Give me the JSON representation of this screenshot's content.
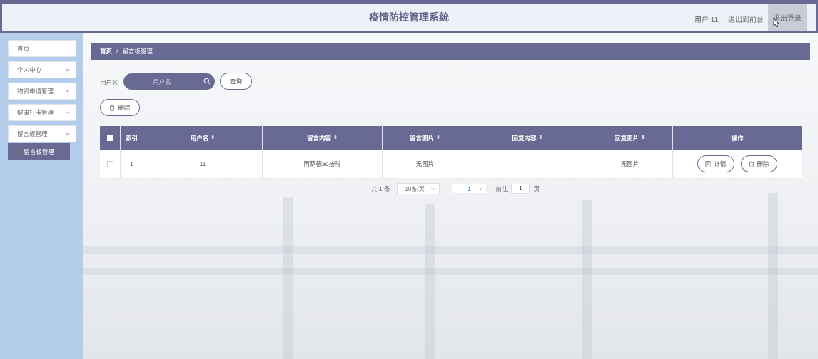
{
  "header": {
    "title": "疫情防控管理系统",
    "user": "用户 11",
    "to_front": "退出到前台",
    "logout": "退出登录"
  },
  "sidebar": {
    "items": [
      {
        "label": "首页",
        "expandable": false
      },
      {
        "label": "个人中心",
        "expandable": true
      },
      {
        "label": "物资申请管理",
        "expandable": true
      },
      {
        "label": "健康打卡管理",
        "expandable": true
      },
      {
        "label": "留言板管理",
        "expandable": true
      }
    ],
    "active_sub": "留言板管理"
  },
  "breadcrumb": {
    "home": "首页",
    "separator": "/",
    "current": "留言板管理"
  },
  "search": {
    "label": "用户名",
    "placeholder": "用户名",
    "button": "查询"
  },
  "actions": {
    "bulk_delete": "删除"
  },
  "table": {
    "columns": [
      "",
      "索引",
      "用户名",
      "留言内容",
      "留言图片",
      "回复内容",
      "回复图片",
      "操作"
    ],
    "rows": [
      {
        "index": "1",
        "username": "11",
        "content": "阿萨德ad按时",
        "image": "无图片",
        "reply": "",
        "reply_image": "无图片",
        "detail_btn": "详情",
        "delete_btn": "删除"
      }
    ]
  },
  "pagination": {
    "total": "共 1 条",
    "page_size": "10条/页",
    "current_page": "1",
    "goto_label": "前往",
    "goto_value": "1",
    "page_suffix": "页"
  },
  "colors": {
    "primary": "#696a93",
    "sidebar_bg": "#b3cdeb",
    "header_bg": "#eef2f8",
    "active_page": "#409eff"
  }
}
